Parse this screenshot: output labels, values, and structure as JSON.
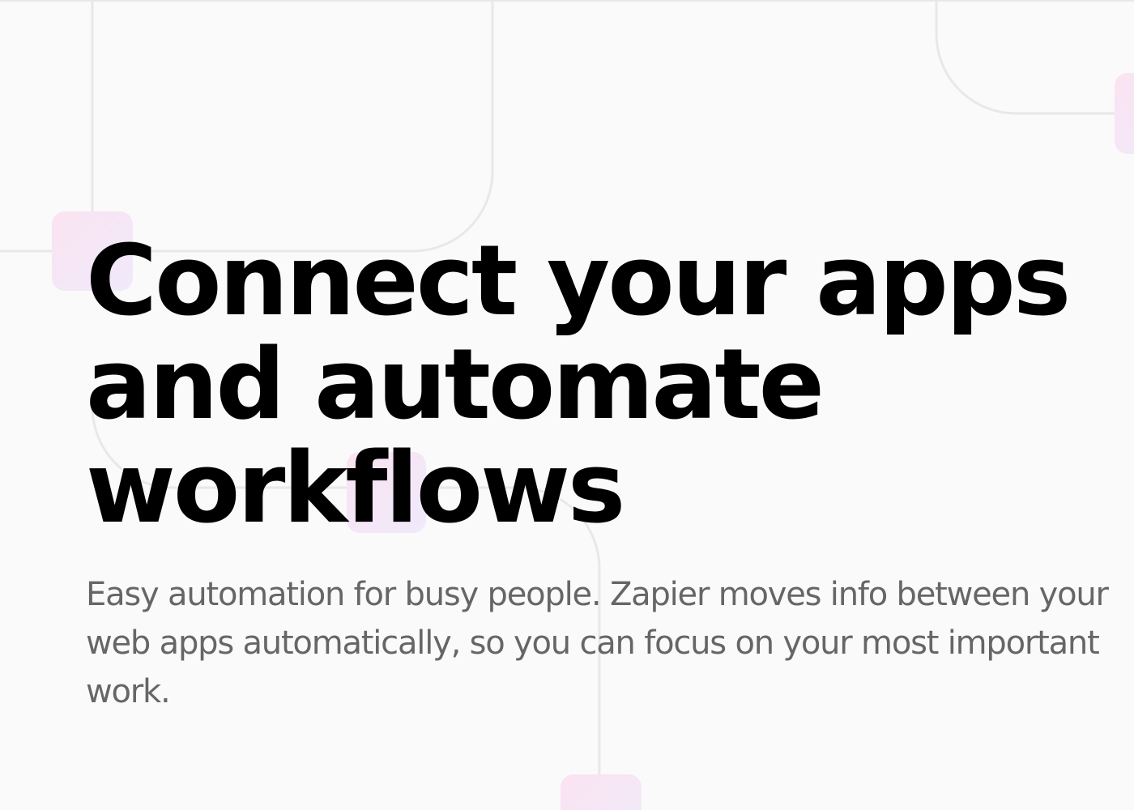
{
  "hero": {
    "title": "Connect your apps and automate workflows",
    "subtitle": "Easy automation for busy people. Zapier moves info between your web apps automatically, so you can focus on your most important work."
  },
  "colors": {
    "background": "#fafafa",
    "title": "#000000",
    "subtitle": "#666666",
    "line": "#e8e8e8",
    "tile_pink": "#fbe6f3",
    "tile_lavender": "#f1ecfb"
  }
}
